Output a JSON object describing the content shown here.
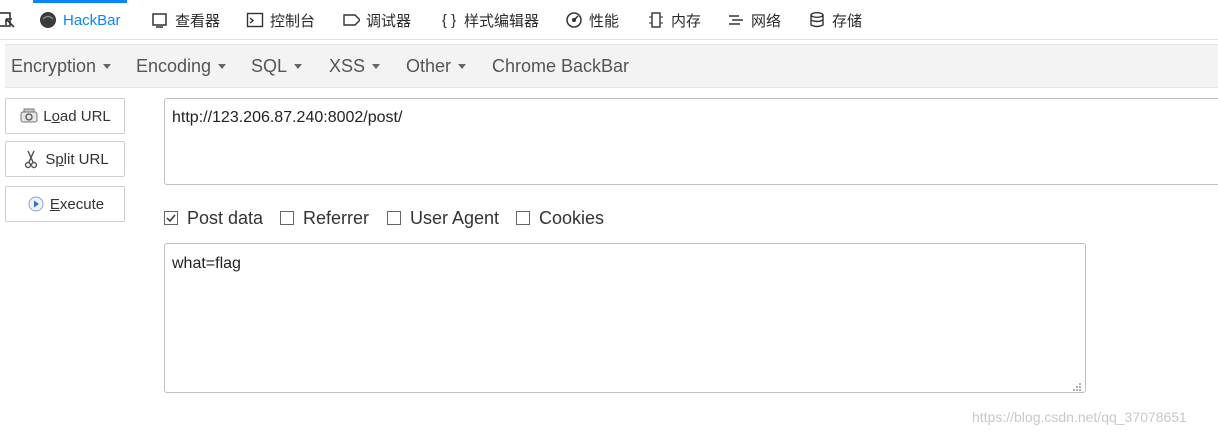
{
  "devtools": {
    "tabs": [
      {
        "label": "HackBar",
        "icon": "hackbar-icon"
      },
      {
        "label": "查看器",
        "icon": "inspector-icon"
      },
      {
        "label": "控制台",
        "icon": "console-icon"
      },
      {
        "label": "调试器",
        "icon": "debugger-icon"
      },
      {
        "label": "样式编辑器",
        "icon": "braces-icon"
      },
      {
        "label": "性能",
        "icon": "performance-icon"
      },
      {
        "label": "内存",
        "icon": "memory-icon"
      },
      {
        "label": "网络",
        "icon": "network-icon"
      },
      {
        "label": "存储",
        "icon": "storage-icon"
      }
    ],
    "active_tab": "HackBar",
    "accent_color": "#0a84ff"
  },
  "menu": {
    "items": [
      "Encryption",
      "Encoding",
      "SQL",
      "XSS",
      "Other",
      "Chrome BackBar"
    ]
  },
  "actions": {
    "load_url": {
      "prefix": "L",
      "accel": "o",
      "rest": "ad URL",
      "icon": "load-url-icon"
    },
    "split_url": {
      "prefix": "S",
      "accel": "p",
      "rest": "lit URL",
      "icon": "scissors-icon"
    },
    "execute": {
      "prefix": "",
      "accel": "E",
      "rest": "xecute",
      "icon": "play-icon"
    }
  },
  "url_field": {
    "value": "http://123.206.87.240:8002/post/"
  },
  "options": [
    {
      "label": "Post data",
      "checked": true
    },
    {
      "label": "Referrer",
      "checked": false
    },
    {
      "label": "User Agent",
      "checked": false
    },
    {
      "label": "Cookies",
      "checked": false
    }
  ],
  "post_field": {
    "value": "what=flag"
  },
  "watermark": "https://blog.csdn.net/qq_37078651"
}
